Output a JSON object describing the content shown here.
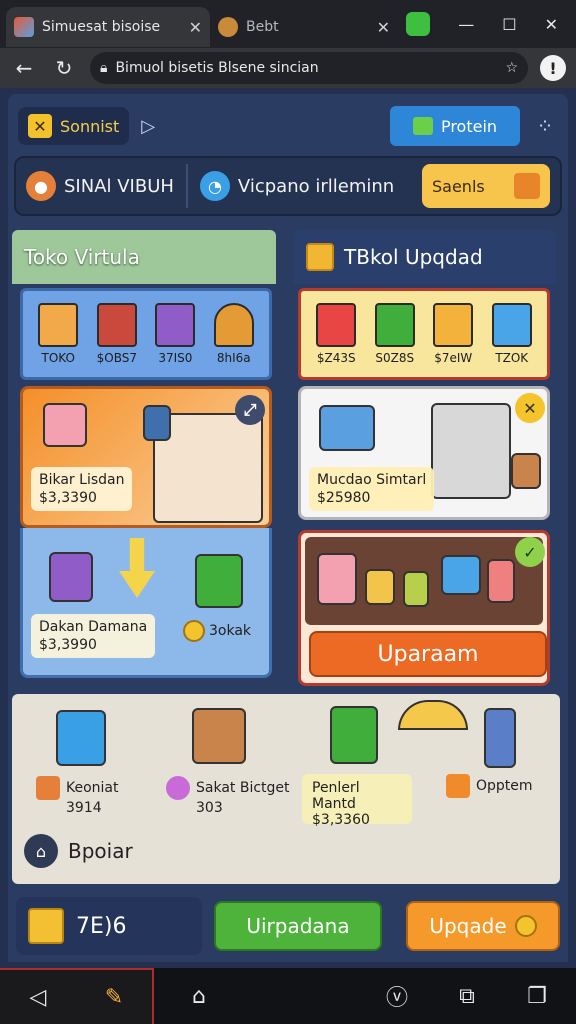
{
  "browser": {
    "tabs": [
      {
        "title": "Simuesat bisoise",
        "active": true
      },
      {
        "title": "Bebt",
        "active": false
      }
    ],
    "url": "Bimuol bisetis Blsene sincian",
    "colors": {
      "chrome": "#202227",
      "toolbar": "#35363a"
    }
  },
  "game": {
    "topbar": {
      "survival_label": "Sonnist",
      "protein_label": "Protein"
    },
    "infobar": {
      "left_label": "SINAl VIBUH",
      "middle_label": "Vicpano irlleminn",
      "status_label": "Saenls"
    },
    "left_panel": {
      "title": "Toko Virtula",
      "shelf_items": [
        {
          "label": "TOKO",
          "color": "#f2a94a",
          "icon": "store-icon"
        },
        {
          "label": "$OBS7",
          "color": "#c94a3d",
          "icon": "box-icon"
        },
        {
          "label": "37IS0",
          "color": "#8f5cc8",
          "icon": "box-icon"
        },
        {
          "label": "8hI6a",
          "color": "#e49a35",
          "icon": "trophy-icon"
        }
      ],
      "card1": {
        "name": "Bikar Lisdan",
        "price": "$3,3390"
      },
      "card2": {
        "name": "Dakan Damana",
        "price": "$3,3990",
        "extra": "3okak"
      }
    },
    "right_panel": {
      "title": "TBkol Upqdad",
      "shelf_items": [
        {
          "label": "$Z43S",
          "color": "#e94545",
          "icon": "box-icon"
        },
        {
          "label": "S0Z8S",
          "color": "#3fae3a",
          "icon": "box-icon"
        },
        {
          "label": "$7eIW",
          "color": "#f2b23c",
          "icon": "box-icon"
        },
        {
          "label": "TZOK",
          "color": "#4aa5e8",
          "icon": "box-icon"
        }
      ],
      "card1": {
        "name": "Mucdao Simtarl",
        "price": "$25980"
      },
      "upgrade_label": "Uparaam"
    },
    "lower": {
      "item1": {
        "name": "Keoniat",
        "value": "3914"
      },
      "item2": {
        "name": "Sakat Bictget",
        "value": "303"
      },
      "item3": {
        "name": "Penlerl Mantd",
        "value": "$3,3360"
      },
      "item4": {
        "name": "Opptem"
      },
      "popular_label": "Bpoiar"
    },
    "bottombar": {
      "coins": "7E)6",
      "green_button": "Uirpadana",
      "orange_button": "Upqade"
    }
  }
}
